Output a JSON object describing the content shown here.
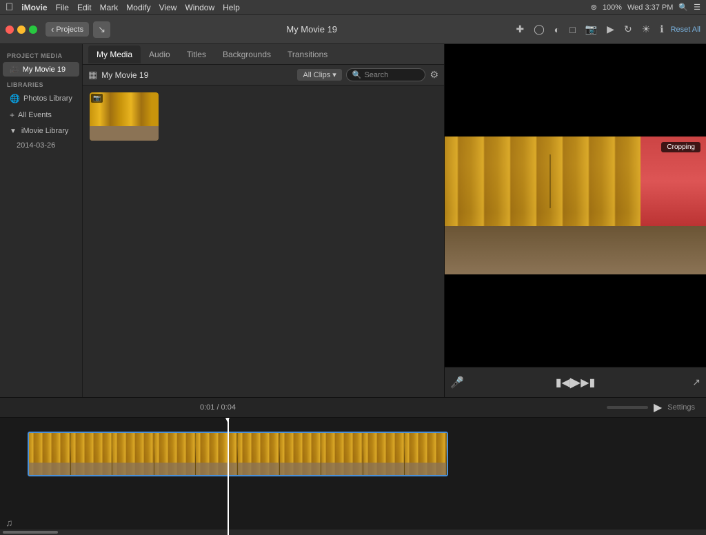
{
  "menubar": {
    "apple": "🍎",
    "app_name": "iMovie",
    "menus": [
      "iMovie",
      "File",
      "Edit",
      "Mark",
      "Modify",
      "View",
      "Window",
      "Help"
    ],
    "right": {
      "time": "Wed 3:37 PM",
      "battery": "100%"
    }
  },
  "toolbar": {
    "projects_label": "Projects",
    "title": "My Movie 19",
    "reset_all": "Reset All"
  },
  "tabs": {
    "items": [
      {
        "label": "My Media",
        "active": true
      },
      {
        "label": "Audio",
        "active": false
      },
      {
        "label": "Titles",
        "active": false
      },
      {
        "label": "Backgrounds",
        "active": false
      },
      {
        "label": "Transitions",
        "active": false
      }
    ]
  },
  "sidebar": {
    "project_media_label": "PROJECT MEDIA",
    "my_movie": "My Movie 19",
    "libraries_label": "LIBRARIES",
    "photos_library": "Photos Library",
    "all_events": "All Events",
    "imovie_library": "iMovie Library",
    "date_item": "2014-03-26"
  },
  "media_browser": {
    "grid_icon": "▦",
    "project_label": "My Movie 19",
    "clips_label": "All Clips",
    "search_placeholder": "Search",
    "settings_icon": "⚙"
  },
  "preview": {
    "cropping_label": "Cropping"
  },
  "playback": {
    "mic_icon": "🎤",
    "skip_back_icon": "⏮",
    "play_icon": "▶",
    "skip_fwd_icon": "⏭",
    "fullscreen_icon": "⤢"
  },
  "timeline": {
    "time_display": "0:01 / 0:04",
    "settings_label": "Settings"
  }
}
